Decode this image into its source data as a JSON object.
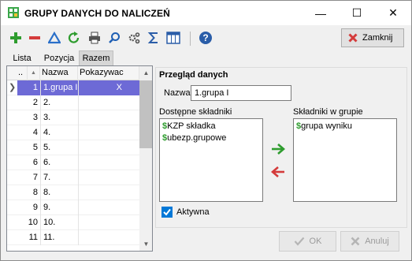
{
  "window": {
    "title": "GRUPY DANYCH DO NALICZEŃ",
    "minimize_glyph": "—",
    "maximize_glyph": "☐",
    "close_glyph": "✕"
  },
  "toolbar": {
    "icons": [
      "add-icon",
      "delete-icon",
      "filter-icon",
      "refresh-icon",
      "print-icon",
      "search-icon",
      "settings-icon",
      "sum-icon",
      "columns-icon",
      "help-icon"
    ],
    "close_label": "Zamknij"
  },
  "tabs": [
    {
      "label": "Lista",
      "active": false
    },
    {
      "label": "Pozycja",
      "active": false
    },
    {
      "label": "Razem",
      "active": true
    }
  ],
  "grid": {
    "columns": {
      "num": "..",
      "name": "Nazwa",
      "show": "Pokazywac"
    },
    "sort_glyph": "▲",
    "current_row_glyph": "❯",
    "rows": [
      {
        "num": "1",
        "name": "1.grupa I",
        "show": "X",
        "selected": true
      },
      {
        "num": "2",
        "name": "2.",
        "show": "",
        "selected": false
      },
      {
        "num": "3",
        "name": "3.",
        "show": "",
        "selected": false
      },
      {
        "num": "4",
        "name": "4.",
        "show": "",
        "selected": false
      },
      {
        "num": "5",
        "name": "5.",
        "show": "",
        "selected": false
      },
      {
        "num": "6",
        "name": "6.",
        "show": "",
        "selected": false
      },
      {
        "num": "7",
        "name": "7.",
        "show": "",
        "selected": false
      },
      {
        "num": "8",
        "name": "8.",
        "show": "",
        "selected": false
      },
      {
        "num": "9",
        "name": "9.",
        "show": "",
        "selected": false
      },
      {
        "num": "10",
        "name": "10.",
        "show": "",
        "selected": false
      },
      {
        "num": "11",
        "name": "11.",
        "show": "",
        "selected": false
      }
    ]
  },
  "details": {
    "section_title": "Przegląd danych",
    "name_label": "Nazwa",
    "name_value": "1.grupa I",
    "available_label": "Dostępne składniki",
    "available_items": [
      {
        "prefix": "$",
        "text": "KZP składka"
      },
      {
        "prefix": "$",
        "text": "ubezp.grupowe"
      }
    ],
    "ingroup_label": "Składniki w grupie",
    "ingroup_items": [
      {
        "prefix": "$",
        "text": "grupa wyniku"
      }
    ],
    "active_label": "Aktywna",
    "active_checked": true
  },
  "buttons": {
    "ok": "OK",
    "cancel": "Anuluj"
  },
  "colors": {
    "selection": "#6d6ad6",
    "green": "#2e9c2e",
    "red": "#d43b3b",
    "blue": "#2a6fc9",
    "check": "#0078d7"
  }
}
